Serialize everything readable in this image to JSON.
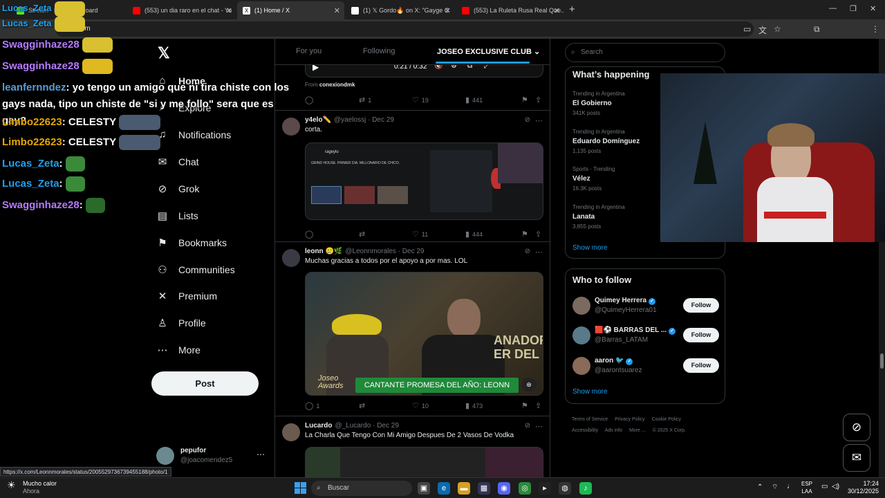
{
  "browser": {
    "tabs": [
      {
        "title": "Stream - Kick Dashboard",
        "color": "#53fc18"
      },
      {
        "title": "(553) un dia raro en el chat - Yo",
        "color": "#ff0000"
      },
      {
        "title": "(1) Home / X",
        "color": "#ffffff"
      },
      {
        "title": "(1) 𝕏 Gordo🔥 on X: \"Gayge C",
        "color": "#ffffff"
      },
      {
        "title": "(553) La Ruleta Rusa Real Que...",
        "color": "#ff0000"
      }
    ],
    "address": "x.com",
    "status_url": "https://x.com/Leonnmorales/status/2005529736739455188/photo/1"
  },
  "chat": {
    "lines": [
      {
        "user": "Lucas_Zeta",
        "color": "#1da1f2"
      },
      {
        "user": "Lucas_Zeta",
        "color": "#1da1f2"
      },
      {
        "user": "Swagginhaze28",
        "color": "#b57bff"
      },
      {
        "user": "Swagginhaze28",
        "color": "#b57bff"
      }
    ],
    "long_user": "leanfernndez",
    "long_msg": "yo tengo un amigo que ni tira chiste con los gays nada, tipo un chiste de \"si y me follo\" sera que es gay?",
    "lines2": [
      {
        "user": "Limbo22623",
        "msg": "CELESTY",
        "color": "#e6a800"
      },
      {
        "user": "Limbo22623",
        "msg": "CELESTY",
        "color": "#e6a800"
      },
      {
        "user": "Lucas_Zeta",
        "msg": "",
        "color": "#1da1f2"
      },
      {
        "user": "Lucas_Zeta",
        "msg": "",
        "color": "#1da1f2"
      },
      {
        "user": "Swagginhaze28",
        "msg": "",
        "color": "#b57bff"
      }
    ]
  },
  "nav": {
    "items": [
      {
        "label": "Home",
        "icon": "home-icon",
        "glyph": "⌂"
      },
      {
        "label": "Explore",
        "icon": "search-icon",
        "glyph": "⌕"
      },
      {
        "label": "Notifications",
        "icon": "bell-icon",
        "glyph": "♫"
      },
      {
        "label": "Chat",
        "icon": "mail-icon",
        "glyph": "✉"
      },
      {
        "label": "Grok",
        "icon": "grok-icon",
        "glyph": "⊘"
      },
      {
        "label": "Lists",
        "icon": "list-icon",
        "glyph": "▤"
      },
      {
        "label": "Bookmarks",
        "icon": "bookmark-icon",
        "glyph": "⚑"
      },
      {
        "label": "Communities",
        "icon": "people-icon",
        "glyph": "⚇"
      },
      {
        "label": "Premium",
        "icon": "x-icon",
        "glyph": "✕"
      },
      {
        "label": "Profile",
        "icon": "person-icon",
        "glyph": "♙"
      },
      {
        "label": "More",
        "icon": "more-icon",
        "glyph": "⋯"
      }
    ],
    "post": "Post",
    "account_name": "pepufor",
    "account_handle": "@joacomendez5"
  },
  "feed": {
    "tabs": [
      "For you",
      "Following",
      "JOSEO EXCLUSIVE CLUB"
    ],
    "video": {
      "time": "0:21 / 0:32",
      "from_label": "From",
      "from_user": "conexiondmk"
    },
    "first_actions": {
      "reply": "",
      "repost": "1",
      "like": "19",
      "views": "441"
    },
    "tweets": [
      {
        "name": "y4elo✏️",
        "handle": "@yaelossj",
        "date": "Dec 29",
        "text": "corta.",
        "reply": "",
        "repost": "",
        "like": "11",
        "views": "444",
        "media_stream_name": "rageylo",
        "media_stream_title": "GRIND HOUSE. PRIMER DIA. MILLONARIO DE CHICO."
      },
      {
        "name": "leonn 🥲🌿",
        "handle": "@Leonnmorales",
        "date": "Dec 29",
        "text": "Muchas gracias a todos por el apoyo a por mas. LOL",
        "reply": "1",
        "repost": "",
        "like": "10",
        "views": "473",
        "media_caption": "CANTANTE PROMESA DEL AÑO: LEONN",
        "media_side": "ANADOR\nER DEL",
        "media_logo": "Joseo\nAwards"
      },
      {
        "name": "Lucardo",
        "handle": "@_Lucardo",
        "date": "Dec 29",
        "text": "La Charla Que Tengo Con Mi Amigo Despues De 2 Vasos De Vodka"
      }
    ]
  },
  "sidebar": {
    "search_placeholder": "Search",
    "happening_title": "What’s happening",
    "trends": [
      {
        "context": "Trending in Argentina",
        "name": "El Gobierno",
        "count": "341K posts"
      },
      {
        "context": "Trending in Argentina",
        "name": "Eduardo Domínguez",
        "count": "1,135 posts"
      },
      {
        "context": "Sports · Trending",
        "name": "Vélez",
        "count": "16.3K posts"
      },
      {
        "context": "Trending in Argentina",
        "name": "Lanata",
        "count": "3,855 posts"
      }
    ],
    "show_more": "Show more",
    "wtf_title": "Who to follow",
    "follow_label": "Follow",
    "suggestions": [
      {
        "name": "Quimey Herrera",
        "handle": "@QuimeyHerrera01"
      },
      {
        "name": "🟥⚽ BARRAS DEL ...",
        "handle": "@Barras_LATAM"
      },
      {
        "name": "aaron 🐦",
        "handle": "@aarontsuarez"
      }
    ],
    "footer": [
      "Terms of Service",
      "Privacy Policy",
      "Cookie Policy",
      "Accessibility",
      "Ads info",
      "More ...",
      "© 2025 X Corp."
    ]
  },
  "taskbar": {
    "weather_title": "Mucho calor",
    "weather_sub": "Ahora",
    "search": "Buscar",
    "lang_top": "ESP",
    "lang_bottom": "LAA",
    "time": "17:24",
    "date": "30/12/2025"
  },
  "colors": {
    "accent": "#1d9bf0",
    "bg": "#000000",
    "border": "#2f3336"
  }
}
